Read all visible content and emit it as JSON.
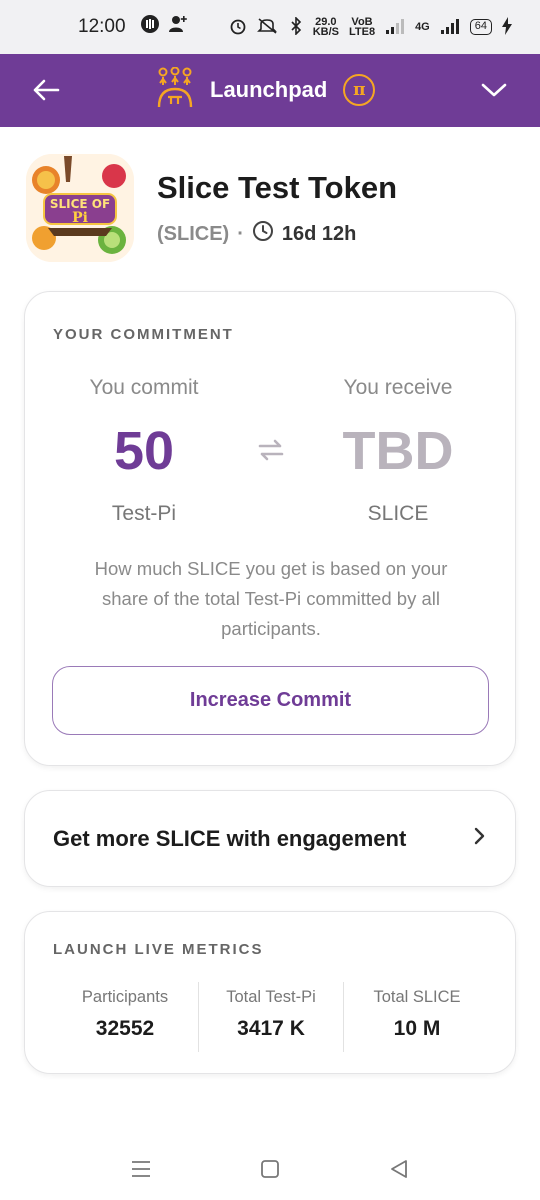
{
  "status_bar": {
    "time": "12:00",
    "network_speed_value": "29.0",
    "network_speed_unit": "KB/S",
    "volte": "VoB",
    "lte": "LTE8",
    "network_4g": "4G",
    "battery": "64"
  },
  "header": {
    "title": "Launchpad",
    "pi_symbol": "π"
  },
  "token": {
    "name": "Slice Test Token",
    "symbol": "(SLICE)",
    "separator": "·",
    "time_remaining": "16d 12h",
    "logo_text_top": "SLICE OF",
    "logo_text_bottom": "Pi"
  },
  "commitment": {
    "section_label": "YOUR COMMITMENT",
    "commit_label": "You commit",
    "commit_value": "50",
    "commit_unit": "Test-Pi",
    "receive_label": "You receive",
    "receive_value": "TBD",
    "receive_unit": "SLICE",
    "explanation": "How much SLICE you get is based on your share of the total Test-Pi committed by all participants.",
    "button_label": "Increase Commit"
  },
  "engagement": {
    "label": "Get more SLICE with engagement"
  },
  "metrics": {
    "section_label": "LAUNCH LIVE METRICS",
    "items": [
      {
        "label": "Participants",
        "value": "32552"
      },
      {
        "label": "Total Test-Pi",
        "value": "3417 K"
      },
      {
        "label": "Total SLICE",
        "value": "10 M"
      }
    ]
  },
  "colors": {
    "brand_purple": "#6f3c96",
    "accent_gold": "#f5a623",
    "tbd_grey": "#b9b3bc"
  }
}
